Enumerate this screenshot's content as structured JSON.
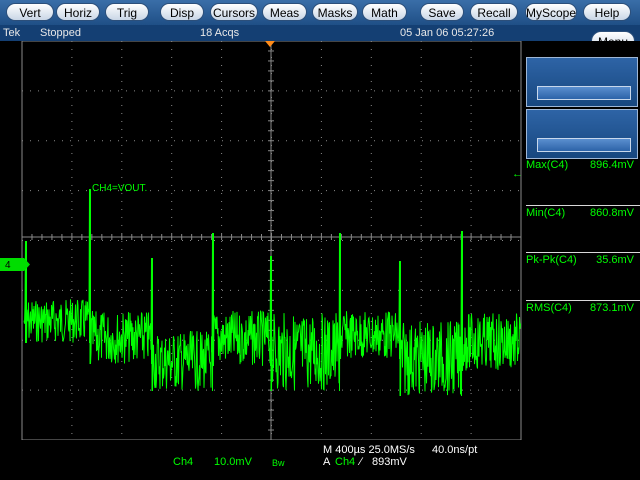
{
  "menu": [
    "Vert",
    "Horiz",
    "Trig",
    "Disp",
    "Cursors",
    "Meas",
    "Masks",
    "Math",
    "Save",
    "Recall",
    "MyScope",
    "Help"
  ],
  "status": {
    "brand": "Tek",
    "state": "Stopped",
    "acqs": "18 Acqs",
    "datetime": "05 Jan 06 05:27:26"
  },
  "menu_button": "Menu",
  "channel_marker": "4",
  "channel_label": "CH4=VOUT.",
  "measurements": [
    {
      "label": "Max(C4)",
      "value": "896.4mV"
    },
    {
      "label": "Min(C4)",
      "value": "860.8mV"
    },
    {
      "label": "Pk-Pk(C4)",
      "value": "35.6mV"
    },
    {
      "label": "RMS(C4)",
      "value": "873.1mV"
    }
  ],
  "bottom": {
    "ch": "Ch4",
    "scale": "10.0mV",
    "bw": "Bw",
    "timebase": "M 400µs 25.0MS/s",
    "resolution": "40.0ns/pt",
    "trigger_mode": "A",
    "trigger_ch": "Ch4",
    "trigger_slope": "∕",
    "trigger_level": "893mV"
  },
  "colors": {
    "trace": "#00ff00",
    "grid": "#8a8a8a",
    "trigger_marker": "#ff8c1a"
  }
}
